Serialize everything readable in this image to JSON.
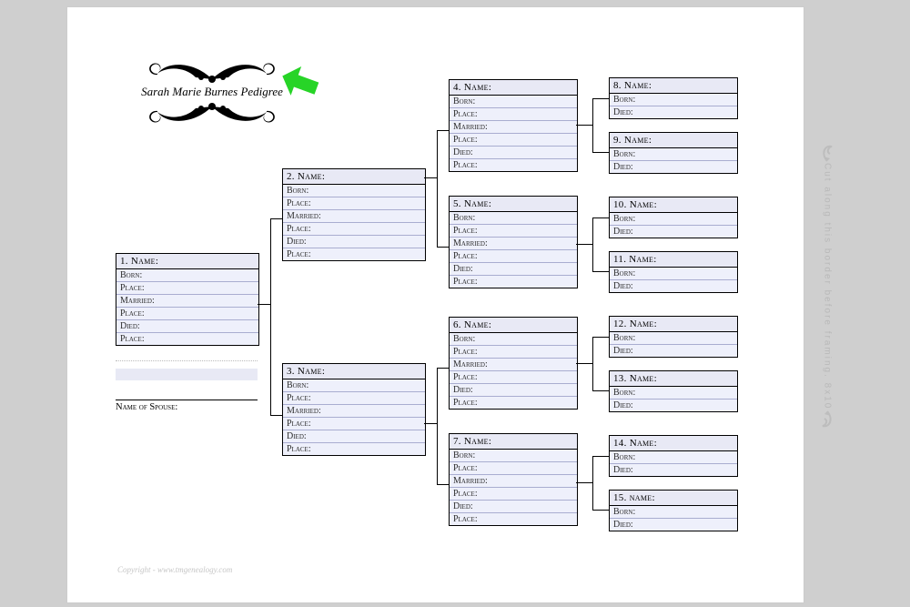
{
  "title": "Sarah Marie Burnes Pedigree",
  "side_note": "Cut along this border before framing. 8x10",
  "copyright": "Copyright - www.tmgenealogy.com",
  "labels": {
    "born": "Born:",
    "place": "Place:",
    "married": "Married:",
    "died": "Died:",
    "spouse": "Name of Spouse:"
  },
  "boxes": {
    "p1": {
      "hdr": "1. Name:"
    },
    "p2": {
      "hdr": "2. Name:"
    },
    "p3": {
      "hdr": "3. Name:"
    },
    "p4": {
      "hdr": "4. Name:"
    },
    "p5": {
      "hdr": "5. Name:"
    },
    "p6": {
      "hdr": "6. Name:"
    },
    "p7": {
      "hdr": "7. Name:"
    },
    "p8": {
      "hdr": "8. Name:"
    },
    "p9": {
      "hdr": "9. Name:"
    },
    "p10": {
      "hdr": "10. Name:"
    },
    "p11": {
      "hdr": "11. Name:"
    },
    "p12": {
      "hdr": "12. Name:"
    },
    "p13": {
      "hdr": "13. Name:"
    },
    "p14": {
      "hdr": "14. Name:"
    },
    "p15": {
      "hdr": "15. name:"
    }
  }
}
